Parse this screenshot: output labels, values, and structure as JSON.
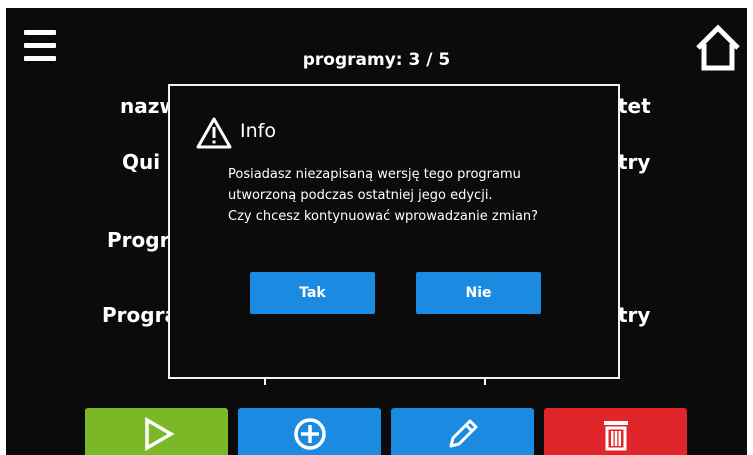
{
  "header": {
    "title": "programy: 3 / 5"
  },
  "background": {
    "row1_left": "nazw",
    "row1_right": "tet",
    "row2_left": "Qui",
    "row2_right": "try",
    "row3_left": "Progr",
    "row4_left": "Progra",
    "row4_right": "try"
  },
  "dialog": {
    "icon": "warning-icon",
    "title": "Info",
    "message_lines": [
      "Posiadasz niezapisaną wersję tego programu",
      "utworzoną podczas ostatniej jego edycji.",
      "Czy chcesz kontynuować wprowadzanie zmian?"
    ],
    "yes_label": "Tak",
    "no_label": "Nie"
  },
  "toolbar": {
    "buttons": [
      {
        "name": "play",
        "icon": "play-icon",
        "color": "#7ab828"
      },
      {
        "name": "add",
        "icon": "plus-circle-icon",
        "color": "#1a8be0"
      },
      {
        "name": "edit",
        "icon": "pencil-icon",
        "color": "#1a8be0"
      },
      {
        "name": "delete",
        "icon": "trash-icon",
        "color": "#e0262a"
      }
    ]
  },
  "colors": {
    "screen_bg": "#0b0b0b",
    "accent_blue": "#1a8be0",
    "green": "#7ab828",
    "red": "#e0262a",
    "text": "#ffffff"
  }
}
